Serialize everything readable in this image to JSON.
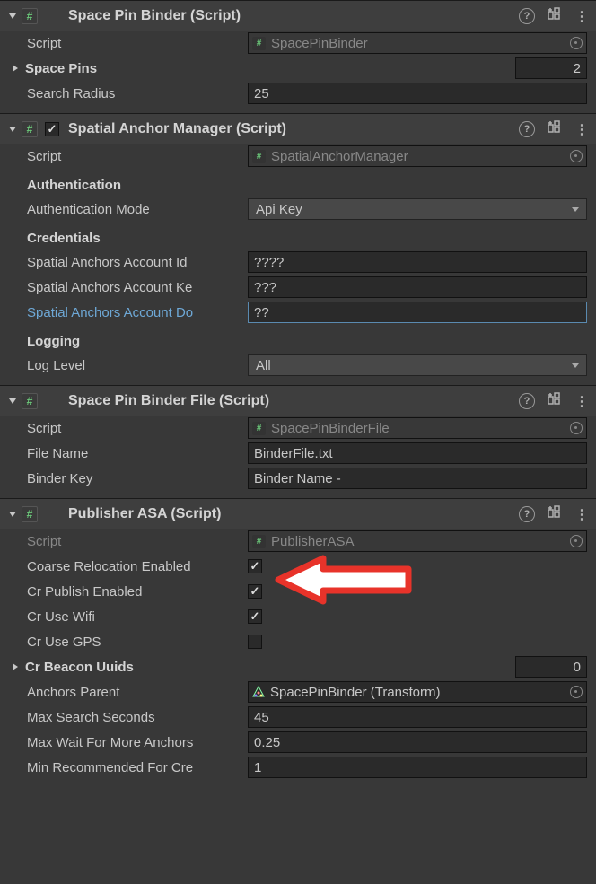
{
  "components": {
    "spacePinBinder": {
      "title": "Space Pin Binder (Script)",
      "scriptLabel": "Script",
      "scriptName": "SpacePinBinder",
      "spacePinsLabel": "Space Pins",
      "spacePinsCount": "2",
      "searchRadiusLabel": "Search Radius",
      "searchRadiusValue": "25"
    },
    "spatialAnchorManager": {
      "title": "Spatial Anchor Manager (Script)",
      "enabled": true,
      "scriptLabel": "Script",
      "scriptName": "SpatialAnchorManager",
      "authHeader": "Authentication",
      "authModeLabel": "Authentication Mode",
      "authModeValue": "Api Key",
      "credentialsHeader": "Credentials",
      "accountIdLabel": "Spatial Anchors Account Id",
      "accountIdValue": "????",
      "accountKeyLabel": "Spatial Anchors Account Ke",
      "accountKeyValue": "???",
      "accountDomainLabel": "Spatial Anchors Account Do",
      "accountDomainValue": "??",
      "loggingHeader": "Logging",
      "logLevelLabel": "Log Level",
      "logLevelValue": "All"
    },
    "spacePinBinderFile": {
      "title": "Space Pin Binder File (Script)",
      "scriptLabel": "Script",
      "scriptName": "SpacePinBinderFile",
      "fileNameLabel": "File Name",
      "fileNameValue": "BinderFile.txt",
      "binderKeyLabel": "Binder Key",
      "binderKeyValue": "Binder Name -"
    },
    "publisherASA": {
      "title": "Publisher ASA (Script)",
      "scriptLabel": "Script",
      "scriptName": "PublisherASA",
      "coarseRelocationLabel": "Coarse Relocation Enabled",
      "coarseRelocationValue": true,
      "crPublishLabel": "Cr Publish Enabled",
      "crPublishValue": true,
      "crUseWifiLabel": "Cr Use Wifi",
      "crUseWifiValue": true,
      "crUseGPSLabel": "Cr Use GPS",
      "crUseGPSValue": false,
      "crBeaconUuidsLabel": "Cr Beacon Uuids",
      "crBeaconUuidsCount": "0",
      "anchorsParentLabel": "Anchors Parent",
      "anchorsParentValue": "SpacePinBinder (Transform)",
      "maxSearchSecondsLabel": "Max Search Seconds",
      "maxSearchSecondsValue": "45",
      "maxWaitLabel": "Max Wait For More Anchors",
      "maxWaitValue": "0.25",
      "minRecommendedLabel": "Min Recommended For Cre",
      "minRecommendedValue": "1"
    }
  }
}
